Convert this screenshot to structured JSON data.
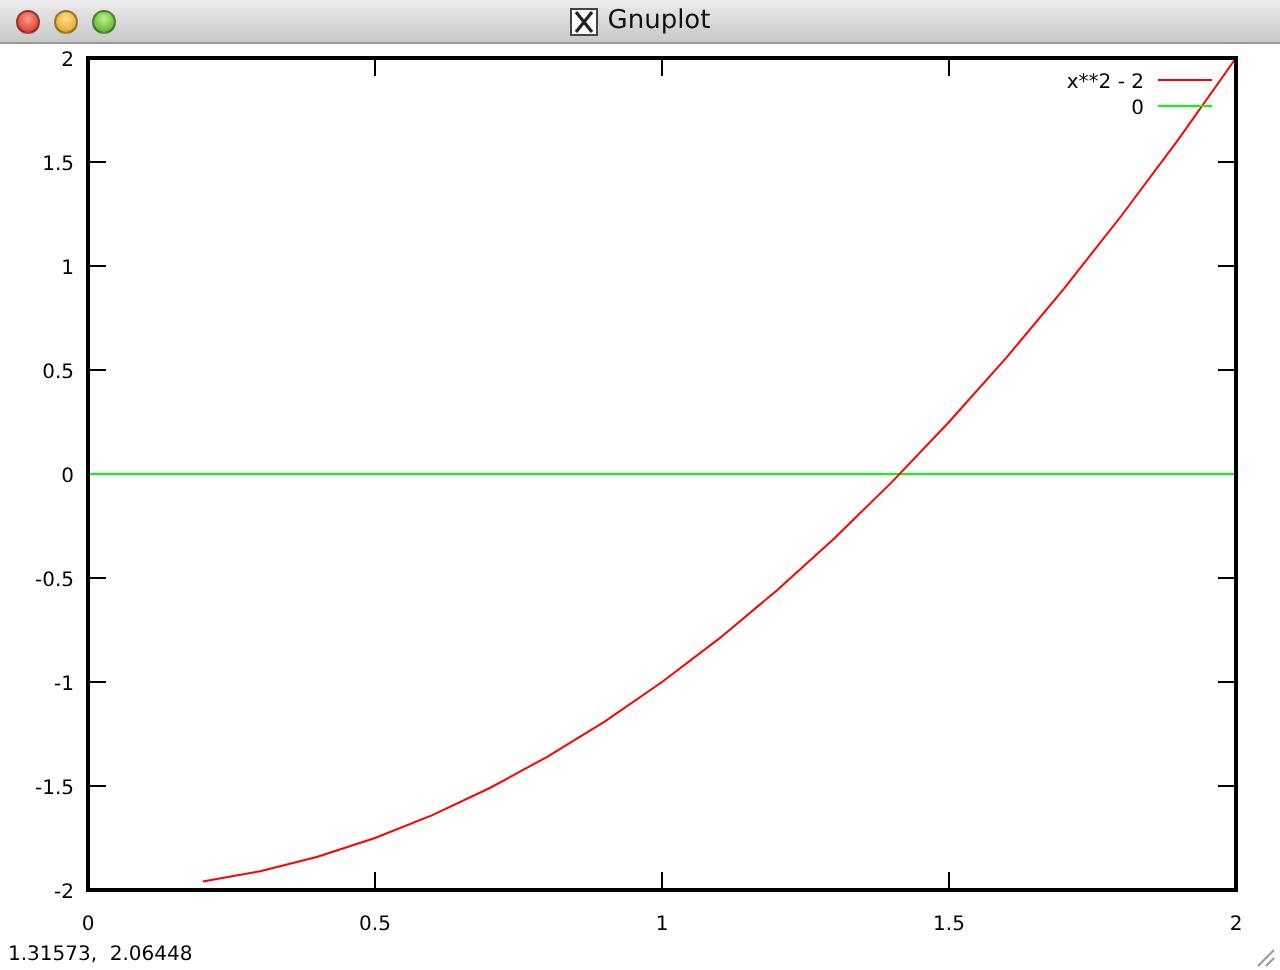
{
  "window": {
    "title": "Gnuplot"
  },
  "plot": {
    "chart_data": {
      "type": "line",
      "x": [
        0,
        0.1,
        0.2,
        0.3,
        0.4,
        0.5,
        0.6,
        0.7,
        0.8,
        0.9,
        1,
        1.1,
        1.2,
        1.3,
        1.4,
        1.5,
        1.6,
        1.7,
        1.8,
        1.9,
        2
      ],
      "series": [
        {
          "name": "x**2 - 2",
          "color": "#ff0000",
          "values": [
            null,
            null,
            -1.96,
            -1.91,
            -1.84,
            -1.75,
            -1.64,
            -1.51,
            -1.36,
            -1.19,
            -1,
            -0.79,
            -0.56,
            -0.31,
            -0.04,
            0.25,
            0.56,
            0.89,
            1.24,
            1.61,
            2
          ]
        },
        {
          "name": "0",
          "color": "#00ff00",
          "values": [
            0,
            0,
            0,
            0,
            0,
            0,
            0,
            0,
            0,
            0,
            0,
            0,
            0,
            0,
            0,
            0,
            0,
            0,
            0,
            0,
            0
          ]
        }
      ],
      "legend": true,
      "xlim": [
        0,
        2
      ],
      "ylim": [
        -2,
        2
      ],
      "xticks": [
        0,
        0.5,
        1,
        1.5,
        2
      ],
      "yticks": [
        -2,
        -1.5,
        -1,
        -0.5,
        0,
        0.5,
        1,
        1.5,
        2
      ]
    }
  },
  "status_bar": {
    "coordinates": "1.31573,  2.06448"
  }
}
